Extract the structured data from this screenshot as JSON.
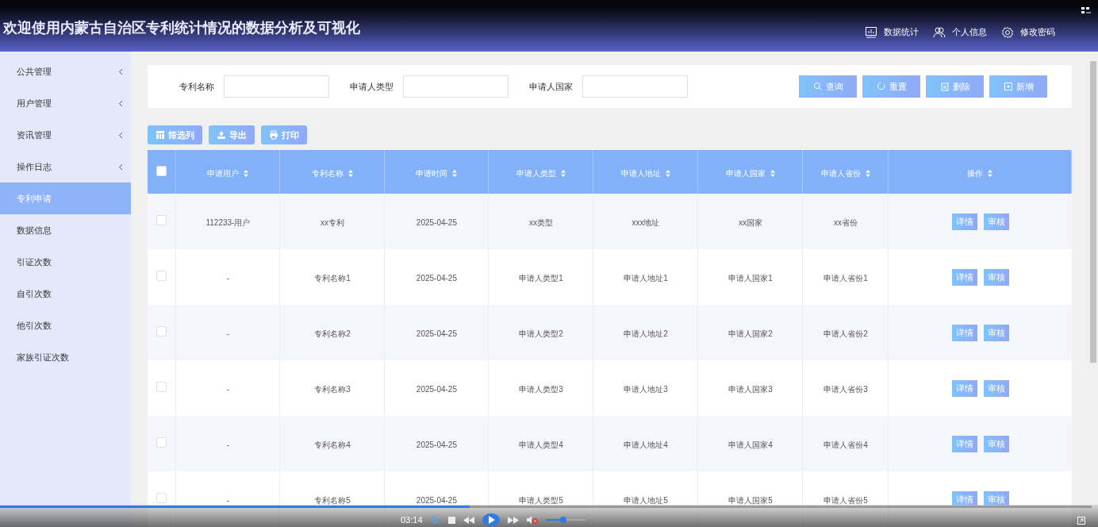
{
  "header": {
    "title": "欢迎使用内蒙古自治区专利统计情况的数据分析及可视化",
    "nav": [
      {
        "label": "数据统计",
        "kind": "chart"
      },
      {
        "label": "个人信息",
        "kind": "users"
      },
      {
        "label": "修改密码",
        "kind": "gear"
      }
    ]
  },
  "sidebar": {
    "items": [
      {
        "label": "公共管理",
        "expandable": true,
        "selected": false
      },
      {
        "label": "用户管理",
        "expandable": true,
        "selected": false
      },
      {
        "label": "资讯管理",
        "expandable": true,
        "selected": false
      },
      {
        "label": "操作日志",
        "expandable": true,
        "selected": false
      },
      {
        "label": "专利申请",
        "expandable": false,
        "selected": true
      },
      {
        "label": "数据信息",
        "expandable": false,
        "selected": false
      },
      {
        "label": "引证次数",
        "expandable": false,
        "selected": false
      },
      {
        "label": "自引次数",
        "expandable": false,
        "selected": false
      },
      {
        "label": "他引次数",
        "expandable": false,
        "selected": false
      },
      {
        "label": "家族引证次数",
        "expandable": false,
        "selected": false
      }
    ]
  },
  "filters": [
    {
      "label": "专利名称"
    },
    {
      "label": "申请人类型"
    },
    {
      "label": "申请人国家"
    }
  ],
  "actions": [
    {
      "label": "查询",
      "kind": "search"
    },
    {
      "label": "重置",
      "kind": "reset"
    },
    {
      "label": "删除",
      "kind": "delete"
    },
    {
      "label": "新增",
      "kind": "add"
    }
  ],
  "toolbar": [
    {
      "label": "筛选列",
      "kind": "columns"
    },
    {
      "label": "导出",
      "kind": "export"
    },
    {
      "label": "打印",
      "kind": "print"
    }
  ],
  "table": {
    "select_all_checked": false,
    "columns": [
      "申请用户",
      "专利名称",
      "申请时间",
      "申请人类型",
      "申请人地址",
      "申请人国家",
      "申请人省份",
      "操作"
    ],
    "rows": [
      {
        "checked": false,
        "cells": [
          "112233-用户",
          "xx专利",
          "2025-04-25",
          "xx类型",
          "xxx地址",
          "xx国家",
          "xx省份"
        ],
        "actions": [
          "详情",
          "审核"
        ]
      },
      {
        "checked": false,
        "cells": [
          "-",
          "专利名称1",
          "2025-04-25",
          "申请人类型1",
          "申请人地址1",
          "申请人国家1",
          "申请人省份1"
        ],
        "actions": [
          "详情",
          "审核"
        ]
      },
      {
        "checked": false,
        "cells": [
          "-",
          "专利名称2",
          "2025-04-25",
          "申请人类型2",
          "申请人地址2",
          "申请人国家2",
          "申请人省份2"
        ],
        "actions": [
          "详情",
          "审核"
        ]
      },
      {
        "checked": false,
        "cells": [
          "-",
          "专利名称3",
          "2025-04-25",
          "申请人类型3",
          "申请人地址3",
          "申请人国家3",
          "申请人省份3"
        ],
        "actions": [
          "详情",
          "审核"
        ]
      },
      {
        "checked": false,
        "cells": [
          "-",
          "专利名称4",
          "2025-04-25",
          "申请人类型4",
          "申请人地址4",
          "申请人国家4",
          "申请人省份4"
        ],
        "actions": [
          "详情",
          "审核"
        ]
      },
      {
        "checked": false,
        "cells": [
          "-",
          "专利名称5",
          "2025-04-25",
          "申请人类型5",
          "申请人地址5",
          "申请人国家5",
          "申请人省份5"
        ],
        "actions": [
          "详情",
          "审核"
        ]
      }
    ]
  },
  "player": {
    "time": "03:14",
    "progress": {
      "level": 0.43
    },
    "volume": {
      "level": 0.45
    },
    "muted": true
  }
}
